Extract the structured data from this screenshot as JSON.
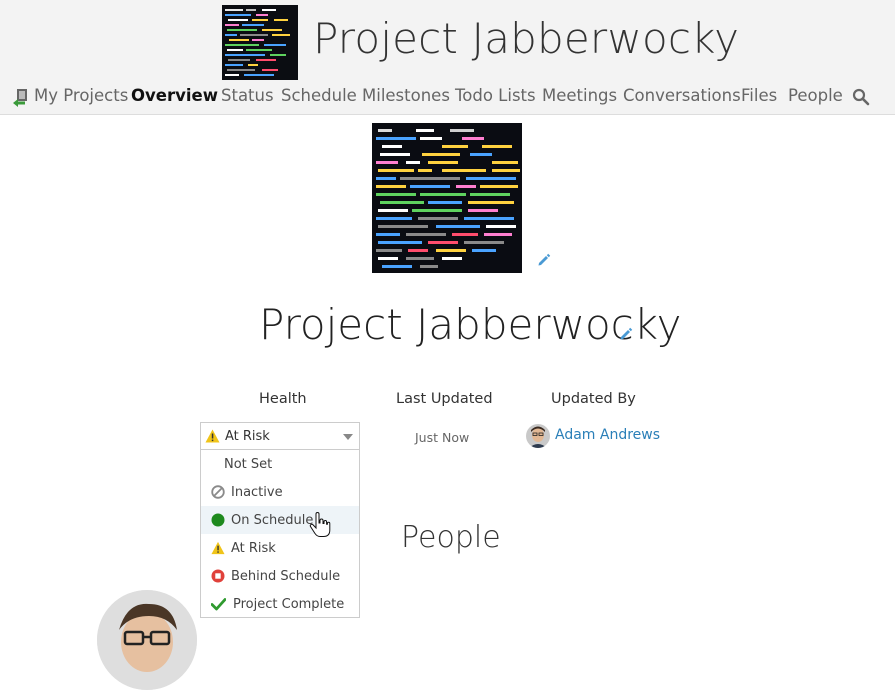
{
  "header": {
    "title": "Project Jabberwocky",
    "nav": [
      {
        "label": "My Projects",
        "active": false
      },
      {
        "label": "Overview",
        "active": true
      },
      {
        "label": "Status",
        "active": false
      },
      {
        "label": "Schedule",
        "active": false
      },
      {
        "label": "Milestones",
        "active": false
      },
      {
        "label": "Todo Lists",
        "active": false
      },
      {
        "label": "Meetings",
        "active": false
      },
      {
        "label": "Conversations",
        "active": false
      },
      {
        "label": "Files",
        "active": false
      },
      {
        "label": "People",
        "active": false
      }
    ]
  },
  "project": {
    "title": "Project Jabberwocky"
  },
  "summary": {
    "health_label": "Health",
    "last_updated_label": "Last Updated",
    "updated_by_label": "Updated By",
    "last_updated_value": "Just Now",
    "updated_by_name": "Adam Andrews"
  },
  "health_select": {
    "selected": "At Risk",
    "selected_icon": "warning-icon",
    "options": [
      {
        "label": "Not Set",
        "icon": ""
      },
      {
        "label": "Inactive",
        "icon": "inactive-icon"
      },
      {
        "label": "On Schedule",
        "icon": "on-schedule-icon"
      },
      {
        "label": "At Risk",
        "icon": "warning-icon"
      },
      {
        "label": "Behind Schedule",
        "icon": "behind-schedule-icon"
      },
      {
        "label": "Project Complete",
        "icon": "checkmark-icon"
      }
    ],
    "hovered_option": "On Schedule"
  },
  "people": {
    "heading": "People"
  },
  "colors": {
    "accent_link": "#2a7fb8",
    "on_schedule": "#1e8a1e",
    "at_risk": "#f0c419",
    "behind_schedule": "#e0413b",
    "complete": "#2f9a2f",
    "header_bg": "#f3f3f3"
  }
}
